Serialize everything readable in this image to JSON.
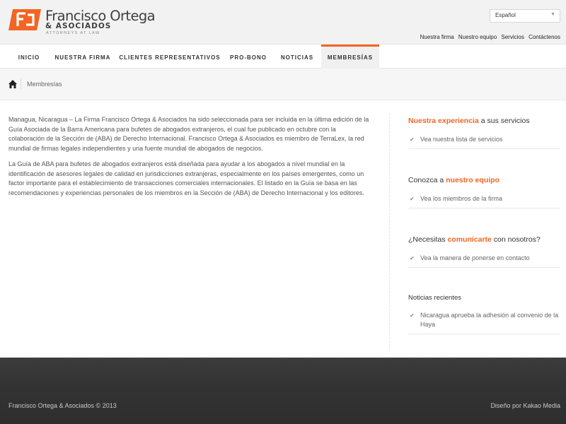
{
  "brand": {
    "name": "Francisco Ortega",
    "sub": "& ASOCIADOS",
    "tagline": "ATTORNEYS AT LAW",
    "accent_color": "#f26522"
  },
  "language": {
    "selected": "Español"
  },
  "top_links": [
    "Nuestra firma",
    "Nuestro equipo",
    "Servicios",
    "Contáctenos"
  ],
  "nav": {
    "items": [
      "INICIO",
      "NUESTRA FIRMA",
      "CLIENTES REPRESENTATIVOS",
      "PRO-BONO",
      "NOTICIAS",
      "MEMBRESÍAS"
    ],
    "active": "MEMBRESÍAS"
  },
  "breadcrumb": {
    "icon": "home-icon",
    "current": "Membresías"
  },
  "content": {
    "paragraphs": [
      "Managua, Nicaragua – La Firma Francisco Ortega & Asociados ha sido seleccionada para ser incluida en la última edición de la Guía Asociada de la Barra Americana para bufetes de abogados extranjeros, el cual fue publicado en octubre con la colaboración de la Sección de (ABA) de Derecho Internacional. Francisco Ortega & Asociados es miembro de TerraLex, la red mundial de firmas legales independientes y una fuente mundial de abogados de negocios.",
      "La Guía de ABA para bufetes de abogados extranjeros está diseñada para ayudar a los abogados a nivel mundial en la identificación de asesores legales de calidad en jurisdicciones extranjeras, especialmente en los países emergentes, como un factor importante para el establecimiento de transacciones comerciales internacionales. El listado en la Guía se basa en las recomendaciones y experiencias personales de los miembros en la Sección de (ABA) de Derecho Internacional y los editores."
    ]
  },
  "sidebar": {
    "s1": {
      "highlight": "Nuestra experiencia",
      "rest": " a sus servicios",
      "link": "Vea nuestra lista de servicios"
    },
    "s2": {
      "pre": "Conozca a ",
      "highlight": "nuestro equipo",
      "link": "Vea los miembros de la firma"
    },
    "s3": {
      "pre": "¿Necesitas ",
      "highlight": "comunicarte",
      "rest": " con nosotros?",
      "link": "Vea la manera de ponerse en contacto"
    },
    "s4": {
      "title": "Noticias recientes",
      "link": "Nicaragua aprueba la adhesión al convenio de la Haya"
    }
  },
  "footer": {
    "copyright": "Francisco Ortega & Asociados © 2013",
    "credit": "Diseño por Kakao Media"
  }
}
